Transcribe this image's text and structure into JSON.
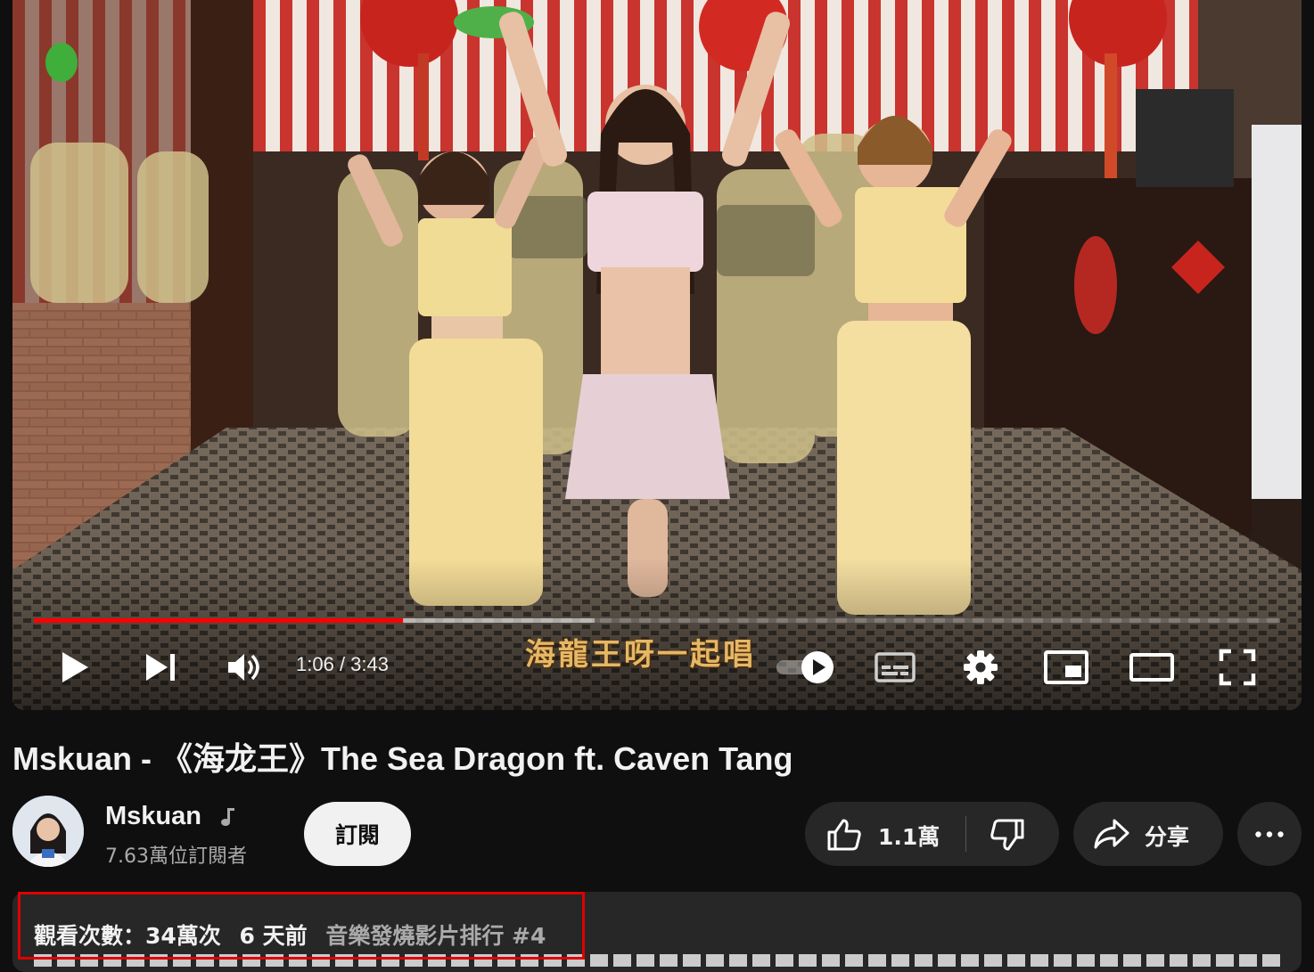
{
  "player": {
    "current_time": "1:06",
    "duration": "3:43",
    "time_display": "1:06 / 3:43",
    "progress_fraction": 0.296,
    "buffered_fraction": 0.45,
    "caption": "海龍王呀一起唱",
    "colors": {
      "progress": "#ff0000"
    },
    "controls": {
      "play": "play-icon",
      "next": "next-icon",
      "volume": "volume-icon",
      "autoplay": "autoplay-toggle-icon",
      "subtitles": "subtitles-icon",
      "settings": "gear-icon",
      "miniplayer": "miniplayer-icon",
      "theater": "theater-icon",
      "fullscreen": "fullscreen-icon"
    }
  },
  "video": {
    "title": "Mskuan - 《海龙王》The Sea Dragon ft. Caven Tang"
  },
  "channel": {
    "name": "Mskuan",
    "subscribers": "7.63萬位訂閱者",
    "subscribe_label": "訂閱"
  },
  "actions": {
    "like_count": "1.1萬",
    "share_label": "分享"
  },
  "description": {
    "views": "觀看次數：34萬次",
    "age": "6 天前",
    "trending": "音樂發燒影片排行 #4"
  }
}
